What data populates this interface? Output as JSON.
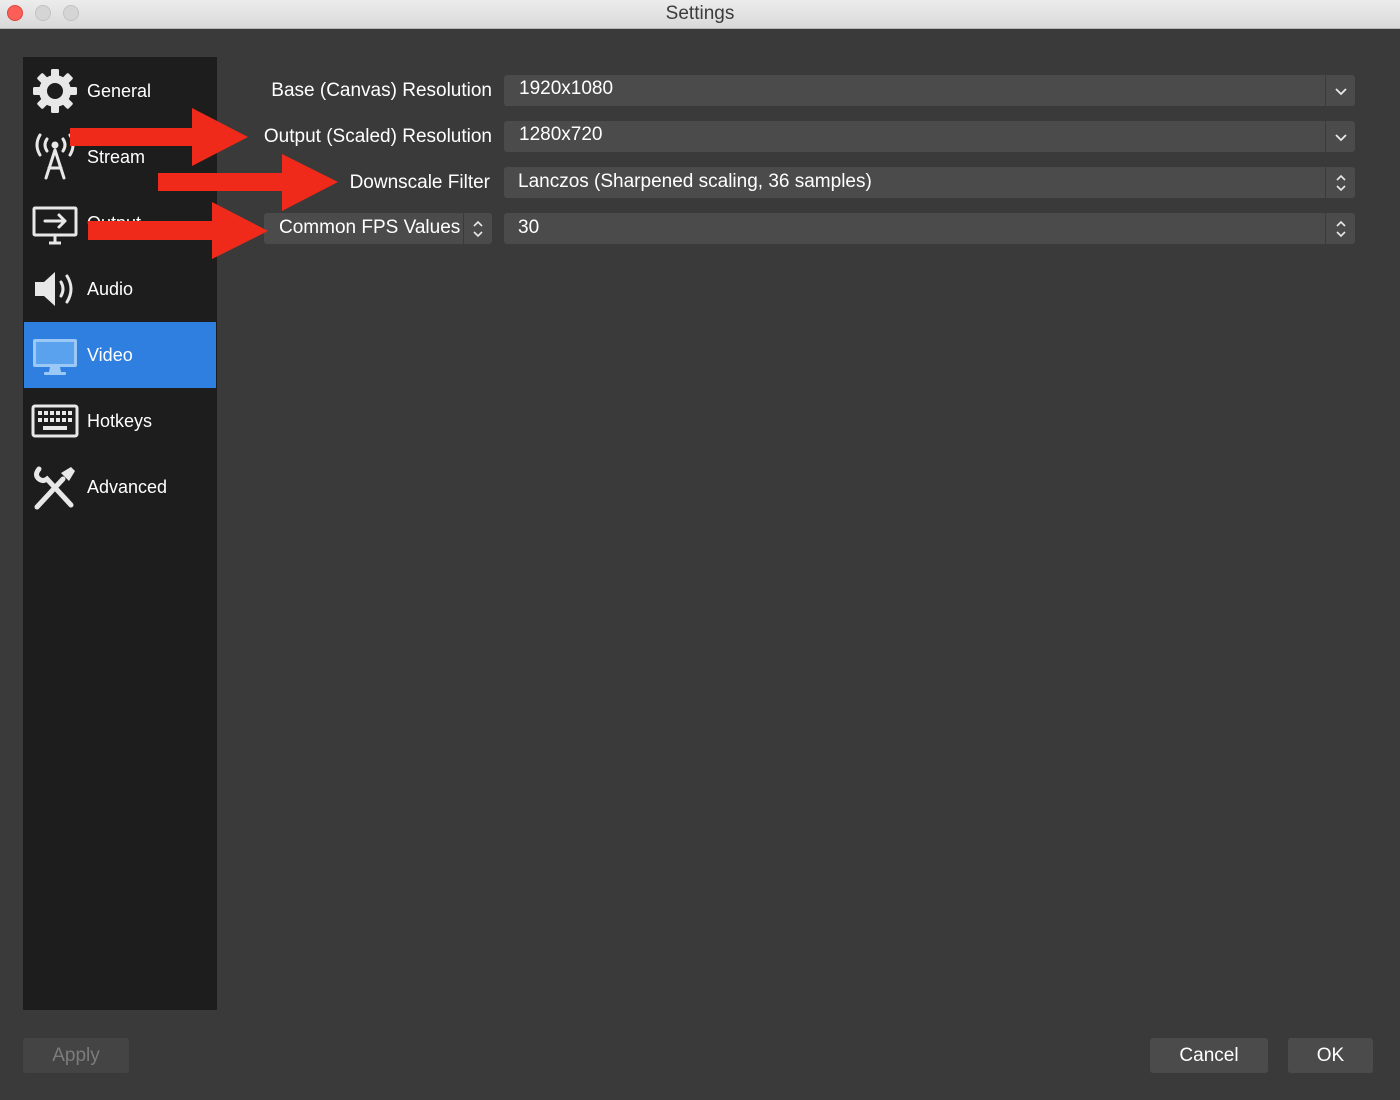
{
  "window": {
    "title": "Settings"
  },
  "sidebar": {
    "items": [
      {
        "label": "General",
        "icon": "gear-icon",
        "active": false
      },
      {
        "label": "Stream",
        "icon": "broadcast-antenna-icon",
        "active": false
      },
      {
        "label": "Output",
        "icon": "output-monitor-icon",
        "active": false
      },
      {
        "label": "Audio",
        "icon": "speaker-icon",
        "active": false
      },
      {
        "label": "Video",
        "icon": "monitor-icon",
        "active": true
      },
      {
        "label": "Hotkeys",
        "icon": "keyboard-icon",
        "active": false
      },
      {
        "label": "Advanced",
        "icon": "tools-icon",
        "active": false
      }
    ]
  },
  "video": {
    "base_resolution_label": "Base (Canvas) Resolution",
    "base_resolution_value": "1920x1080",
    "output_resolution_label": "Output (Scaled) Resolution",
    "output_resolution_value": "1280x720",
    "downscale_filter_label": "Downscale Filter",
    "downscale_filter_value": "Lanczos (Sharpened scaling, 36 samples)",
    "fps_type_value": "Common FPS Values",
    "fps_value": "30"
  },
  "footer": {
    "apply_label": "Apply",
    "cancel_label": "Cancel",
    "ok_label": "OK"
  },
  "colors": {
    "accent": "#2f7fe1",
    "annotation_arrow": "#f02a1a",
    "panel_bg": "#3a3a3a",
    "sidebar_bg": "#1d1d1d"
  }
}
